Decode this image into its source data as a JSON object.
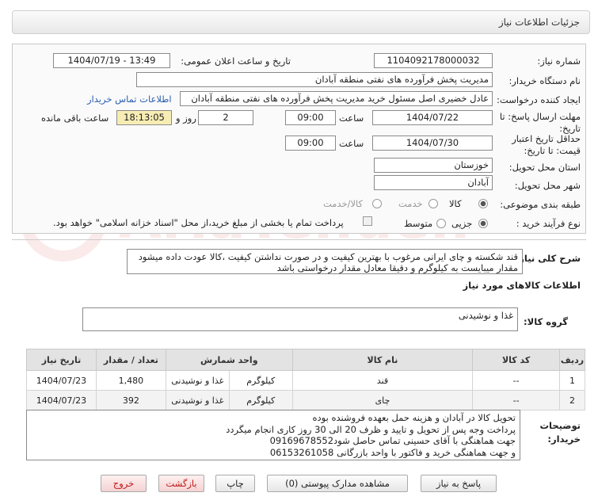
{
  "header": {
    "title": "جزئیات اطلاعات نیاز"
  },
  "fields": {
    "need_number_label": "شماره نیاز:",
    "need_number": "1104092178000032",
    "announce_label": "تاریخ و ساعت اعلان عمومی:",
    "announce_value": "1404/07/19 - 13:49",
    "buyer_org_label": "نام دستگاه خریدار:",
    "buyer_org": "مدیریت پخش فرآورده های نفتی منطقه آبادان",
    "creator_label": "ایجاد کننده درخواست:",
    "creator": "عادل خضیری اصل مسئول خرید مدیریت پخش فرآورده های نفتی منطقه آبادان",
    "contact_link": "اطلاعات تماس خریدار",
    "deadline_label": "مهلت ارسال پاسخ: تا تاریخ:",
    "deadline_date": "1404/07/22",
    "time_label": "ساعت",
    "deadline_time": "09:00",
    "days_value": "2",
    "days_label": "روز و",
    "remaining_time": "18:13:05",
    "remaining_label": "ساعت باقی مانده",
    "validity_label": "حداقل تاریخ اعتبار قیمت: تا تاریخ:",
    "validity_date": "1404/07/30",
    "validity_time": "09:00",
    "province_label": "استان محل تحویل:",
    "province": "خوزستان",
    "city_label": "شهر محل تحویل:",
    "city": "آبادان",
    "category_label": "طبقه بندی موضوعی:",
    "category_options": [
      "کالا",
      "خدمت",
      "کالا/خدمت"
    ],
    "process_label": "نوع فرآیند خرید :",
    "process_options": [
      "جزیی",
      "متوسط"
    ],
    "payment_note": "پرداخت تمام یا بخشی از مبلغ خرید،از محل \"اسناد خزانه اسلامی\" خواهد بود."
  },
  "description": {
    "label": "شرح کلی نیاز:",
    "text": "قند شکسته و چای ایرانی مرغوب با بهترین کیفیت و در صورت نداشتن کیفیت ،کالا عودت داده میشود مقدار میبایست به کیلوگرم و دقیقا معادل مقدار درخواستی باشد"
  },
  "goods_info_title": "اطلاعات کالاهای مورد نیاز",
  "goods_group": {
    "label": "گروه کالا:",
    "value": "غذا و نوشیدنی"
  },
  "table": {
    "headers": [
      "ردیف",
      "کد کالا",
      "نام کالا",
      "واحد شمارش",
      "تعداد / مقدار",
      "تاریخ نیاز"
    ],
    "rows": [
      [
        "1",
        "--",
        "قند",
        "کیلوگرم",
        "غذا و نوشیدنی",
        "1,480",
        "1404/07/23"
      ],
      [
        "2",
        "--",
        "چای",
        "کیلوگرم",
        "غذا و نوشیدنی",
        "392",
        "1404/07/23"
      ]
    ]
  },
  "buyer_notes": {
    "label_line1": "توضیحات",
    "label_line2": "خریدار:",
    "lines": [
      "تحویل کالا در آبادان و هزینه حمل بعهده فروشنده بوده",
      "پرداخت وجه پس از تحویل و تایید و ظرف 20 الی 30 روز کاری انجام میگردد",
      "جهت هماهنگی با آقای حسینی تماس حاصل شود09169678552",
      "و جهت هماهنگی خرید و فاکتور با واحد بازرگانی 06153261058"
    ]
  },
  "buttons": {
    "reply": "پاسخ به نیاز",
    "docs": "مشاهده مدارک پیوستی (0)",
    "print": "چاپ",
    "back": "بازگشت",
    "exit": "خروج"
  },
  "watermark": "AriaTender.net",
  "colors": {
    "link": "#2a5db0",
    "timer_bg": "#f7ecb3",
    "exit_text": "#c01818"
  }
}
